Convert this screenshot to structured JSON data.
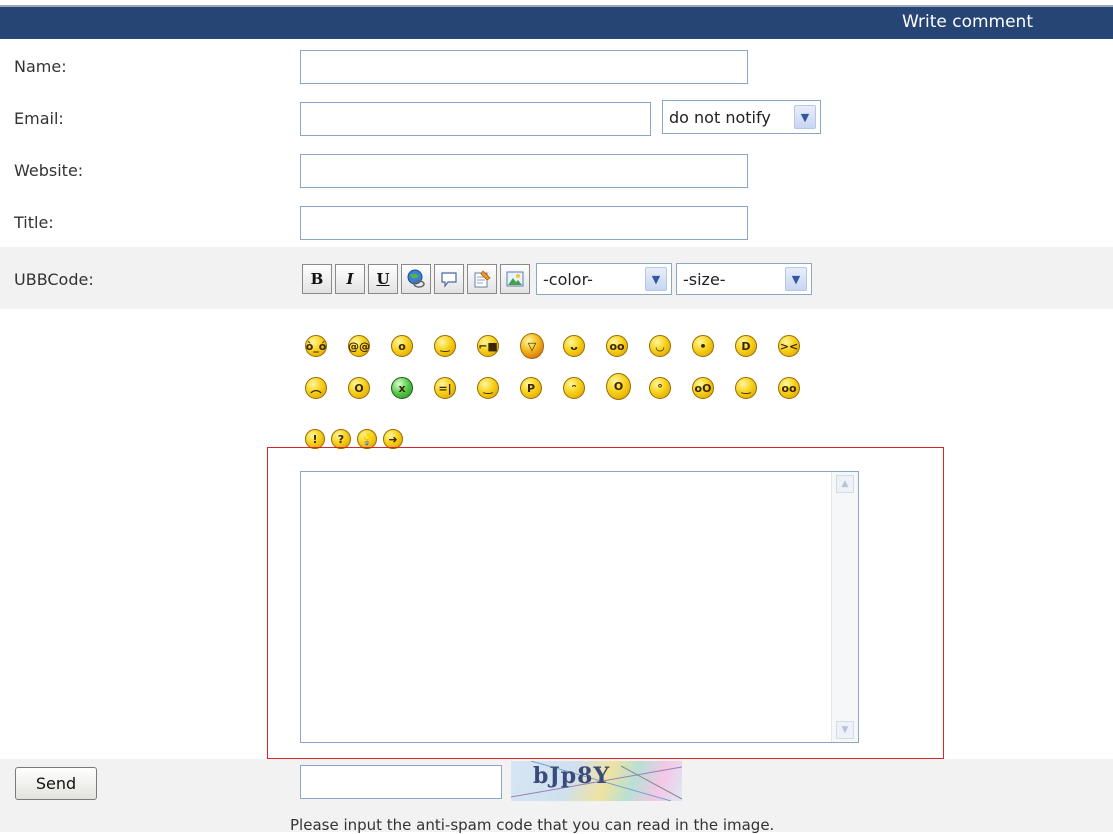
{
  "header": {
    "title": "Write comment"
  },
  "form": {
    "name_label": "Name:",
    "email_label": "Email:",
    "website_label": "Website:",
    "title_label": "Title:",
    "ubbcode_label": "UBBCode:",
    "name_value": "",
    "email_value": "",
    "website_value": "",
    "title_value": "",
    "notify_selected": "do not notify"
  },
  "toolbar": {
    "bold_label": "B",
    "italic_label": "I",
    "underline_label": "U",
    "link_icon": "globe-link-icon",
    "quote_icon": "speech-bubble-icon",
    "code_icon": "edit-document-icon",
    "image_icon": "insert-image-icon",
    "color_selected": "-color-",
    "size_selected": "-size-"
  },
  "smilies_row1": [
    "😠",
    "😵",
    "😮",
    "😀",
    "😎",
    "😈",
    "😣",
    "😳",
    "😊",
    "😮",
    "😁",
    "😖"
  ],
  "smilies_row2": [
    "😟",
    "😲",
    "🤢",
    "😑",
    "🙂",
    "😋",
    "😝",
    "😱",
    "😯",
    "😏",
    "🙂",
    "😵"
  ],
  "smilies_row3": [
    "!",
    "?",
    "💡",
    "➜"
  ],
  "comment": {
    "value": ""
  },
  "send_label": "Send",
  "captcha": {
    "input_value": "",
    "image_text": "bJp8Y",
    "hint": "Please input the anti-spam code that you can read in the image."
  },
  "colors": {
    "header_bg": "#264474",
    "field_border": "#8aa7c6",
    "highlight_border": "#d9242a"
  }
}
